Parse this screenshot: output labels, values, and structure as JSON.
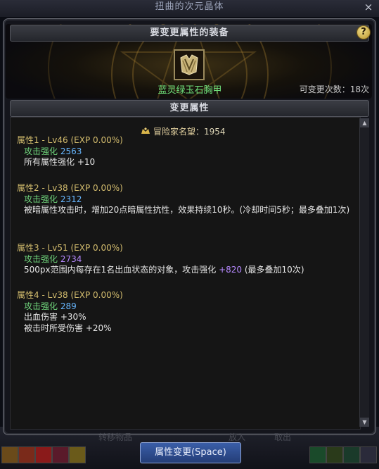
{
  "window": {
    "title": "扭曲的次元晶体",
    "close_label": "×"
  },
  "equip_section": {
    "header": "要变更属性的装备",
    "help_label": "?"
  },
  "item": {
    "name": "蓝灵绿玉石胸甲",
    "change_count_label": "可变更次数：18次",
    "icon": "chestplate-icon"
  },
  "attr_section": {
    "header": "变更属性"
  },
  "fame": {
    "icon": "fame-icon",
    "label": "冒险家名望",
    "value": "：1954"
  },
  "attributes": [
    {
      "title": "属性1 - Lv46 (EXP 0.00%)",
      "lines": [
        {
          "prefix": "攻击强化 ",
          "value": "2563"
        },
        {
          "text": "所有属性强化 +10"
        }
      ]
    },
    {
      "title": "属性2 - Lv38 (EXP 0.00%)",
      "lines": [
        {
          "prefix": "攻击强化 ",
          "value": "2312"
        },
        {
          "text": "被暗属性攻击时，增加20点暗属性抗性，效果持续10秒。(冷却时间5秒；最多叠加1次)"
        }
      ]
    },
    {
      "title": "属性3 - Lv51 (EXP 0.00%)",
      "lines": [
        {
          "prefix": "攻击强化 ",
          "value": "2734"
        },
        {
          "text_a": "500px范围内每存在1名出血状态的对象，攻击强化 ",
          "value": "+820",
          "text_b": " (最多叠加10次)"
        }
      ]
    },
    {
      "title": "属性4 - Lv38 (EXP 0.00%)",
      "lines": [
        {
          "prefix": "攻击强化 ",
          "value": "289"
        },
        {
          "text": "出血伤害 +30%"
        },
        {
          "text": "被击时所受伤害 +20%"
        }
      ]
    }
  ],
  "bottom": {
    "action_button": "属性变更(Space)",
    "faded_left": "转移物品",
    "faded_mid": "放入",
    "faded_right": "取出"
  },
  "colors": {
    "item_name": "#6fe07b",
    "attr_title": "#d4bd6e",
    "value_blue": "#67b7ff",
    "value_purple": "#b689ff",
    "button": "#2f4f95"
  }
}
